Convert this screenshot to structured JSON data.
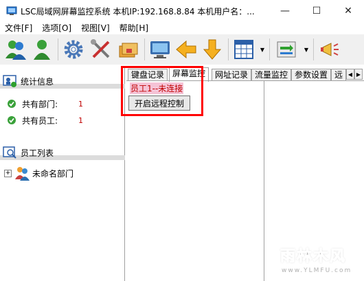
{
  "window": {
    "title": "LSC局域网屏幕监控系统    本机IP:192.168.8.84    本机用户名：...",
    "minimize_glyph": "—",
    "maximize_glyph": "☐",
    "close_glyph": "✕"
  },
  "menu": [
    {
      "label": "文件[F]"
    },
    {
      "label": "选项[O]"
    },
    {
      "label": "视图[V]"
    },
    {
      "label": "帮助[H]"
    }
  ],
  "toolbar": {
    "icons": [
      "users-icon",
      "user-icon",
      "gear-icon",
      "tools-icon",
      "folders-icon",
      "monitor-icon",
      "arrow-left-icon",
      "arrow-down-icon",
      "grid-icon",
      "transfer-icon",
      "megaphone-icon"
    ],
    "dropdown_glyph": "▼"
  },
  "left": {
    "stats_title": "统计信息",
    "stats": [
      {
        "label": "共有部门:",
        "value": "1"
      },
      {
        "label": "共有员工:",
        "value": "1"
      }
    ],
    "employees_title": "员工列表",
    "tree": [
      {
        "label": "未命名部门",
        "expander": "+"
      }
    ]
  },
  "tabs": [
    {
      "label": "键盘记录",
      "active": false
    },
    {
      "label": "屏幕监控",
      "active": true
    },
    {
      "label": "网址记录",
      "active": false
    },
    {
      "label": "流量监控",
      "active": false
    },
    {
      "label": "参数设置",
      "active": false
    },
    {
      "label": "远",
      "active": false
    }
  ],
  "tab_scroll": {
    "left": "◀",
    "right": "▶"
  },
  "screen_monitor": {
    "status": "员工1--未连接",
    "remote_button": "开启远程控制"
  },
  "colors": {
    "highlight": "#ff0000",
    "status_text": "#c00000",
    "status_bg": "#f5c3d6"
  },
  "watermark": {
    "text": "雨林木风",
    "url": "www.YLMFU.com"
  }
}
